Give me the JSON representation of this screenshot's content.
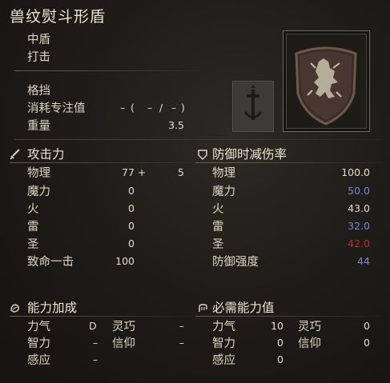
{
  "item": {
    "name": "兽纹熨斗形盾",
    "type": "中盾",
    "attack_type": "打击",
    "skill_label": "格挡",
    "fp_label": "消耗专注值",
    "fp_values": [
      "–",
      "(",
      "–",
      "/",
      "–",
      ")"
    ],
    "weight_label": "重量",
    "weight_value": "3.5"
  },
  "attack": {
    "title": "攻击力",
    "rows": [
      {
        "label": "物理",
        "value": "77 +",
        "extra": "5"
      },
      {
        "label": "魔力",
        "value": "0"
      },
      {
        "label": "火",
        "value": "0"
      },
      {
        "label": "雷",
        "value": "0"
      },
      {
        "label": "圣",
        "value": "0"
      },
      {
        "label": "致命一击",
        "value": "100"
      }
    ]
  },
  "guard": {
    "title": "防御时减伤率",
    "rows": [
      {
        "label": "物理",
        "value": "100.0",
        "color": "#e1dbcb"
      },
      {
        "label": "魔力",
        "value": "50.0",
        "color": "#7a83d6"
      },
      {
        "label": "火",
        "value": "43.0",
        "color": "#e1dbcb"
      },
      {
        "label": "雷",
        "value": "32.0",
        "color": "#7a83d6"
      },
      {
        "label": "圣",
        "value": "42.0",
        "color": "#c0302c"
      },
      {
        "label": "防御强度",
        "value": "44",
        "color": "#7a83d6"
      }
    ]
  },
  "scaling": {
    "title": "能力加成",
    "str_label": "力气",
    "str_value": "D",
    "dex_label": "灵巧",
    "dex_value": "–",
    "int_label": "智力",
    "int_value": "–",
    "fai_label": "信仰",
    "fai_value": "–",
    "arc_label": "感应",
    "arc_value": "–"
  },
  "requirements": {
    "title": "必需能力值",
    "str_label": "力气",
    "str_value": "10",
    "dex_label": "灵巧",
    "dex_value": "0",
    "int_label": "智力",
    "int_value": "0",
    "fai_label": "信仰",
    "fai_value": "0",
    "arc_label": "感应",
    "arc_value": "0"
  },
  "colors": {
    "text": "#d8d2c2",
    "blue_stat": "#7a83d6",
    "red_stat": "#c0302c"
  }
}
